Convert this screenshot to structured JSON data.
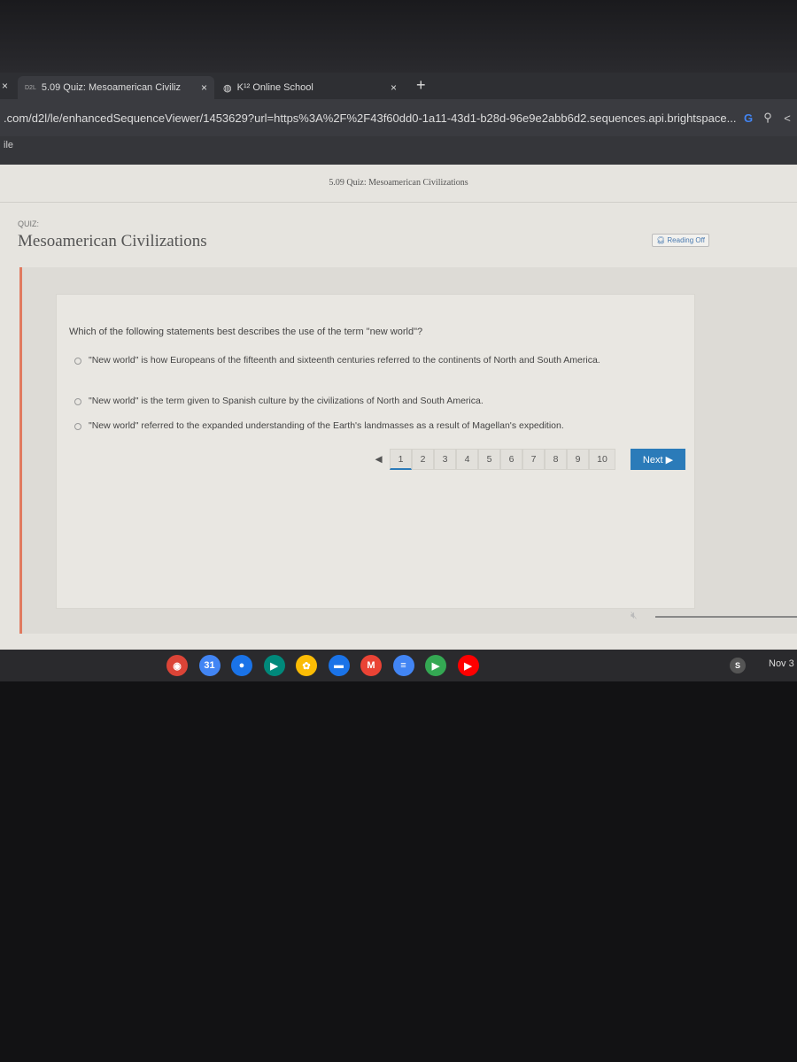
{
  "browser": {
    "tabs": [
      {
        "label": "5.09 Quiz: Mesoamerican Civiliz",
        "favicon": "d2l-icon",
        "active": true
      },
      {
        "label": "K¹² Online School",
        "favicon": "globe-icon",
        "active": false
      }
    ],
    "new_tab": "+",
    "close": "×",
    "url": ".com/d2l/le/enhancedSequenceViewer/1453629?url=https%3A%2F%2F43f60dd0-1a11-43d1-b28d-96e9e2abb6d2.sequences.api.brightspace...",
    "bookmark": "ile"
  },
  "page": {
    "breadcrumb": "5.09 Quiz: Mesoamerican Civilizations",
    "quiz_label": "QUIZ:",
    "title": "Mesoamerican Civilizations",
    "reading": "Reading  Off",
    "question": "Which of the following statements best describes the use of the term \"new world\"?",
    "options": [
      "\"New world\" is how Europeans of the fifteenth and sixteenth centuries referred to the continents of North and South America.",
      "\"New world\" is the term given to Spanish culture by the civilizations of North and South America.",
      "\"New world\" referred to the expanded understanding of the Earth's landmasses as a result of Magellan's expedition."
    ],
    "pages": [
      "1",
      "2",
      "3",
      "4",
      "5",
      "6",
      "7",
      "8",
      "9",
      "10"
    ],
    "current_page": "1",
    "prev": "◀",
    "next": "Next ▶"
  },
  "shelf": {
    "apps": [
      {
        "name": "chrome",
        "color": "#db4437",
        "glyph": "◉"
      },
      {
        "name": "calendar",
        "color": "#4285f4",
        "glyph": "31"
      },
      {
        "name": "messages",
        "color": "#1a73e8",
        "glyph": "●"
      },
      {
        "name": "meet",
        "color": "#00897b",
        "glyph": "▶"
      },
      {
        "name": "photos",
        "color": "#fbbc05",
        "glyph": "✿"
      },
      {
        "name": "files",
        "color": "#1a73e8",
        "glyph": "▬"
      },
      {
        "name": "gmail",
        "color": "#ea4335",
        "glyph": "M"
      },
      {
        "name": "docs",
        "color": "#4285f4",
        "glyph": "≡"
      },
      {
        "name": "play-store",
        "color": "#34a853",
        "glyph": "▶"
      },
      {
        "name": "youtube",
        "color": "#ff0000",
        "glyph": "▶"
      }
    ],
    "status_icon": "S",
    "date": "Nov 3"
  }
}
